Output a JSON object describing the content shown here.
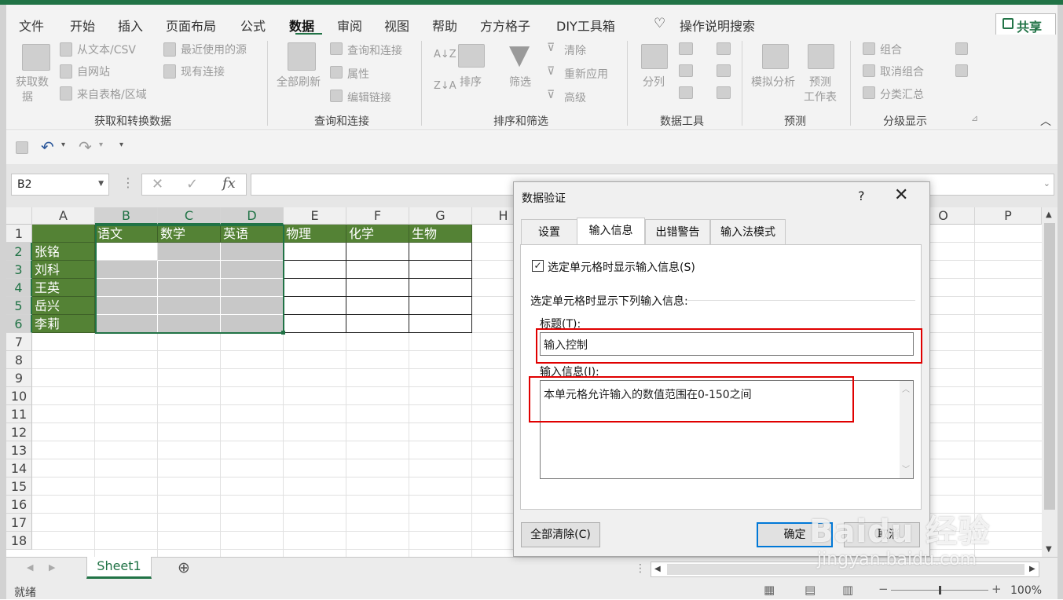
{
  "menu": {
    "items": [
      "文件",
      "开始",
      "插入",
      "页面布局",
      "公式",
      "数据",
      "审阅",
      "视图",
      "帮助",
      "方方格子",
      "DIY工具箱"
    ],
    "search": "操作说明搜索",
    "share": "共享"
  },
  "ribbon": {
    "get": {
      "big": "获取数",
      "big2": "据",
      "b1": "从文本/CSV",
      "b2": "自网站",
      "b3": "来自表格/区域",
      "b4": "最近使用的源",
      "b5": "现有连接",
      "label": "获取和转换数据"
    },
    "query": {
      "big": "全部刷新",
      "b1": "查询和连接",
      "b2": "属性",
      "b3": "编辑链接",
      "label": "查询和连接"
    },
    "sort": {
      "sort": "排序",
      "filter": "筛选",
      "clear": "清除",
      "reapply": "重新应用",
      "adv": "高级",
      "label": "排序和筛选"
    },
    "tools": {
      "split": "分列",
      "label": "数据工具"
    },
    "forecast": {
      "whatif": "模拟分析",
      "sheet": "预测",
      "sheet2": "工作表",
      "label": "预测"
    },
    "outline": {
      "group": "组合",
      "ungroup": "取消组合",
      "subtotal": "分类汇总",
      "label": "分级显示"
    }
  },
  "namebox": "B2",
  "columns": [
    "A",
    "B",
    "C",
    "D",
    "E",
    "F",
    "G",
    "H",
    "O",
    "P"
  ],
  "rows": [
    "1",
    "2",
    "3",
    "4",
    "5",
    "6",
    "7",
    "8",
    "9",
    "10",
    "11",
    "12",
    "13",
    "14",
    "15",
    "16",
    "17",
    "18"
  ],
  "headers": [
    "语文",
    "数学",
    "英语",
    "物理",
    "化学",
    "生物"
  ],
  "names": [
    "张铭",
    "刘科",
    "王英",
    "岳兴",
    "李莉"
  ],
  "sheet": "Sheet1",
  "status": {
    "ready": "就绪",
    "zoom": "100%"
  },
  "dialog": {
    "title": "数据验证",
    "help": "?",
    "close": "✕",
    "tabs": [
      "设置",
      "输入信息",
      "出错警告",
      "输入法模式"
    ],
    "checkbox": "选定单元格时显示输入信息(S)",
    "section": "选定单元格时显示下列输入信息:",
    "title_label": "标题(T):",
    "title_value": "输入控制",
    "info_label": "输入信息(I):",
    "info_value": "本单元格允许输入的数值范围在0-150之间",
    "clear_all": "全部清除(C)",
    "ok": "确定",
    "cancel": "取消"
  },
  "watermark": {
    "brand": "Baidu 经验",
    "url": "jingyan.baidu.com"
  }
}
